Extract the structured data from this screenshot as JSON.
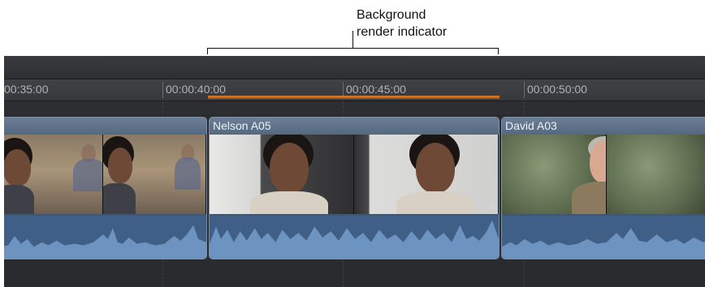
{
  "annotation": {
    "line1": "Background",
    "line2": "render indicator"
  },
  "ruler": {
    "ticks": [
      "00:35:00",
      "00:00:40:00",
      "00:00:45:00",
      "00:00:50:00"
    ]
  },
  "clips": [
    {
      "title": ""
    },
    {
      "title": "Nelson A05"
    },
    {
      "title": "David A03"
    }
  ],
  "colors": {
    "render_indicator": "#e0822c",
    "clip_header": "#6c7f96",
    "audio_waveform": "#6d93c0",
    "timeline_bg": "#2a2b2e"
  }
}
